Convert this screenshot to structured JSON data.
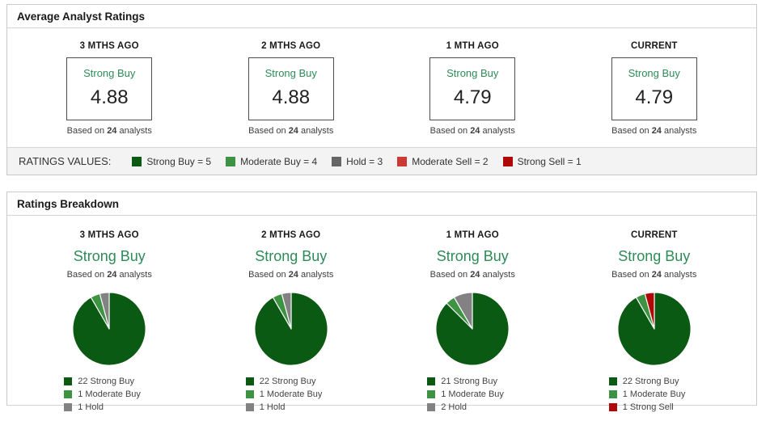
{
  "ratings_panel": {
    "title": "Average Analyst Ratings",
    "columns": [
      {
        "period": "3 MTHS AGO",
        "rating": "Strong Buy",
        "value": "4.88",
        "based": {
          "prefix": "Based on ",
          "count": "24",
          "suffix": " analysts"
        }
      },
      {
        "period": "2 MTHS AGO",
        "rating": "Strong Buy",
        "value": "4.88",
        "based": {
          "prefix": "Based on ",
          "count": "24",
          "suffix": " analysts"
        }
      },
      {
        "period": "1 MTH AGO",
        "rating": "Strong Buy",
        "value": "4.79",
        "based": {
          "prefix": "Based on ",
          "count": "24",
          "suffix": " analysts"
        }
      },
      {
        "period": "CURRENT",
        "rating": "Strong Buy",
        "value": "4.79",
        "based": {
          "prefix": "Based on ",
          "count": "24",
          "suffix": " analysts"
        }
      }
    ],
    "values_legend": {
      "label": "RATINGS VALUES:",
      "items": [
        {
          "label": "Strong Buy = 5",
          "color": "#0a5a14"
        },
        {
          "label": "Moderate Buy = 4",
          "color": "#3e9343"
        },
        {
          "label": "Hold = 3",
          "color": "#666666"
        },
        {
          "label": "Moderate Sell = 2",
          "color": "#cc3b33"
        },
        {
          "label": "Strong Sell = 1",
          "color": "#b00707"
        }
      ]
    }
  },
  "breakdown_panel": {
    "title": "Ratings Breakdown",
    "columns": [
      {
        "period": "3 MTHS AGO",
        "rating": "Strong Buy",
        "based": {
          "prefix": "Based on ",
          "count": "24",
          "suffix": " analysts"
        }
      },
      {
        "period": "2 MTHS AGO",
        "rating": "Strong Buy",
        "based": {
          "prefix": "Based on ",
          "count": "24",
          "suffix": " analysts"
        }
      },
      {
        "period": "1 MTH AGO",
        "rating": "Strong Buy",
        "based": {
          "prefix": "Based on ",
          "count": "24",
          "suffix": " analysts"
        }
      },
      {
        "period": "CURRENT",
        "rating": "Strong Buy",
        "based": {
          "prefix": "Based on ",
          "count": "24",
          "suffix": " analysts"
        }
      }
    ]
  },
  "chart_data": [
    {
      "type": "pie",
      "title": "3 MTHS AGO",
      "center_label": "Strong Buy",
      "total_analysts": 24,
      "slices": [
        {
          "label": "22 Strong Buy",
          "value": 22,
          "color": "#0a5a14"
        },
        {
          "label": "1 Moderate Buy",
          "value": 1,
          "color": "#3e9343"
        },
        {
          "label": "1 Hold",
          "value": 1,
          "color": "#828282"
        }
      ]
    },
    {
      "type": "pie",
      "title": "2 MTHS AGO",
      "center_label": "Strong Buy",
      "total_analysts": 24,
      "slices": [
        {
          "label": "22 Strong Buy",
          "value": 22,
          "color": "#0a5a14"
        },
        {
          "label": "1 Moderate Buy",
          "value": 1,
          "color": "#3e9343"
        },
        {
          "label": "1 Hold",
          "value": 1,
          "color": "#828282"
        }
      ]
    },
    {
      "type": "pie",
      "title": "1 MTH AGO",
      "center_label": "Strong Buy",
      "total_analysts": 24,
      "slices": [
        {
          "label": "21 Strong Buy",
          "value": 21,
          "color": "#0a5a14"
        },
        {
          "label": "1 Moderate Buy",
          "value": 1,
          "color": "#3e9343"
        },
        {
          "label": "2 Hold",
          "value": 2,
          "color": "#828282"
        }
      ]
    },
    {
      "type": "pie",
      "title": "CURRENT",
      "center_label": "Strong Buy",
      "total_analysts": 24,
      "slices": [
        {
          "label": "22 Strong Buy",
          "value": 22,
          "color": "#0a5a14"
        },
        {
          "label": "1 Moderate Buy",
          "value": 1,
          "color": "#3e9343"
        },
        {
          "label": "1 Strong Sell",
          "value": 1,
          "color": "#b00707"
        }
      ]
    }
  ]
}
